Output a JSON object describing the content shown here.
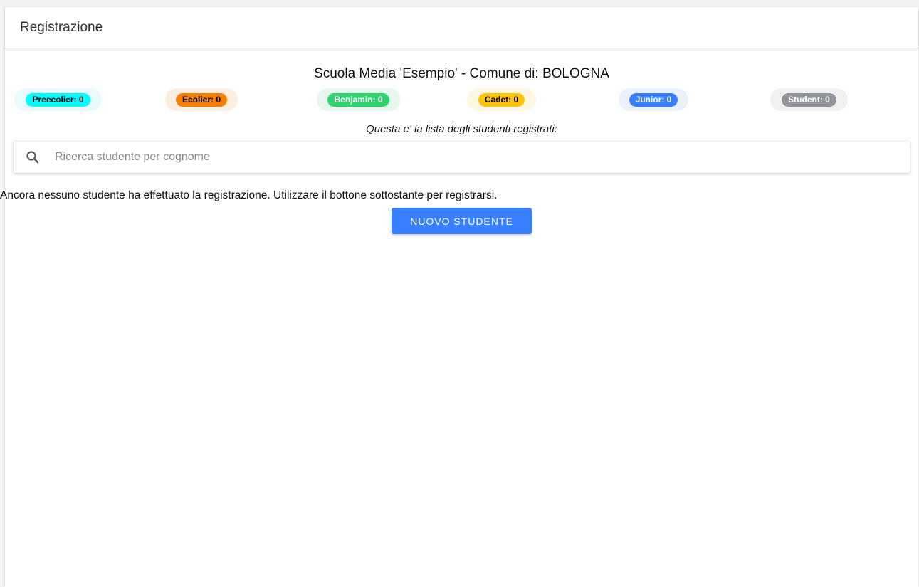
{
  "toolbar": {
    "title": "Registrazione"
  },
  "school": {
    "title": "Scuola Media 'Esempio' - Comune di: BOLOGNA"
  },
  "categories": [
    {
      "label": "Preecolier: 0",
      "chip_color": "#00ffff",
      "text_color": "#000000",
      "wrap_color": "#e8fbfc"
    },
    {
      "label": "Ecolier: 0",
      "chip_color": "#f77f00",
      "text_color": "#000000",
      "wrap_color": "#fdeee2"
    },
    {
      "label": "Benjamin: 0",
      "chip_color": "#2dd36f",
      "text_color": "#ffffff",
      "wrap_color": "#e8f7ee"
    },
    {
      "label": "Cadet: 0",
      "chip_color": "#ffc409",
      "text_color": "#000000",
      "wrap_color": "#fff7e3"
    },
    {
      "label": "Junior: 0",
      "chip_color": "#3880ff",
      "text_color": "#ffffff",
      "wrap_color": "#ebf1fc"
    },
    {
      "label": "Student: 0",
      "chip_color": "#92949c",
      "text_color": "#ffffff",
      "wrap_color": "#f1f1f2"
    }
  ],
  "list": {
    "caption": "Questa e' la lista degli studenti registrati:",
    "empty_message": "Ancora nessuno studente ha effettuato la registrazione. Utilizzare il bottone sottostante per registrarsi."
  },
  "search": {
    "icon": "search-icon",
    "placeholder": "Ricerca studente per cognome",
    "value": ""
  },
  "actions": {
    "new_student_label": "NUOVO STUDENTE",
    "color": "#3880ff"
  }
}
